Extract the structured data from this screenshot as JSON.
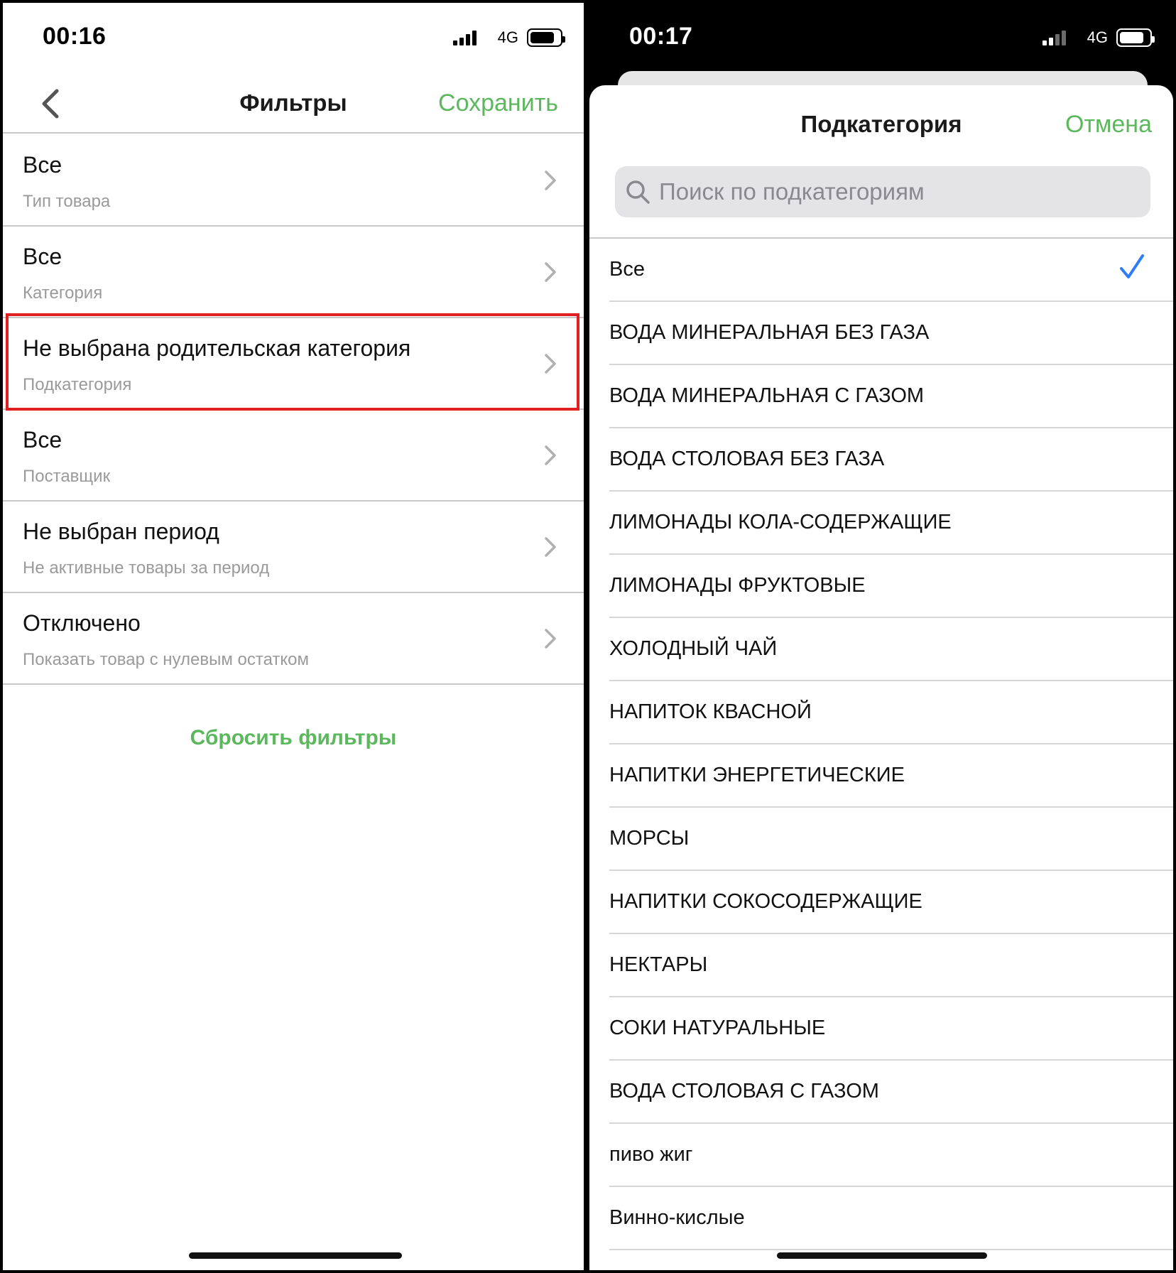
{
  "left": {
    "status": {
      "time": "00:16",
      "network": "4G"
    },
    "nav": {
      "title": "Фильтры",
      "save_label": "Сохранить"
    },
    "rows": [
      {
        "value": "Все",
        "label": "Тип товара"
      },
      {
        "value": "Все",
        "label": "Категория"
      },
      {
        "value": "Не выбрана родительская категория",
        "label": "Подкатегория"
      },
      {
        "value": "Все",
        "label": "Поставщик"
      },
      {
        "value": "Не выбран период",
        "label": "Не активные товары за период"
      },
      {
        "value": "Отключено",
        "label": "Показать товар с нулевым остатком"
      }
    ],
    "reset_label": "Сбросить фильтры"
  },
  "right": {
    "status": {
      "time": "00:17",
      "network": "4G"
    },
    "sheet": {
      "title": "Подкатегория",
      "cancel_label": "Отмена"
    },
    "search": {
      "placeholder": "Поиск по подкатегориям",
      "value": ""
    },
    "selected_index": 0,
    "items": [
      "Все",
      "ВОДА МИНЕРАЛЬНАЯ БЕЗ ГАЗА",
      "ВОДА МИНЕРАЛЬНАЯ С ГАЗОМ",
      "ВОДА СТОЛОВАЯ БЕЗ ГАЗА",
      "ЛИМОНАДЫ КОЛА-СОДЕРЖАЩИЕ",
      "ЛИМОНАДЫ ФРУКТОВЫЕ",
      "ХОЛОДНЫЙ ЧАЙ",
      "НАПИТОК КВАСНОЙ",
      "НАПИТКИ ЭНЕРГЕТИЧЕСКИЕ",
      "МОРСЫ",
      "НАПИТКИ СОКОСОДЕРЖАЩИЕ",
      "НЕКТАРЫ",
      "СОКИ НАТУРАЛЬНЫЕ",
      "ВОДА СТОЛОВАЯ С ГАЗОМ",
      "пиво жиг",
      "Винно-кислые"
    ]
  },
  "colors": {
    "accent_green": "#5cb85c",
    "highlight_red": "#e02020",
    "check_blue": "#2f7cf6"
  }
}
